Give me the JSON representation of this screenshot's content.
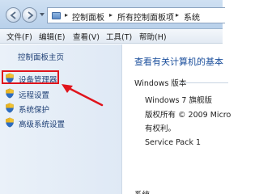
{
  "breadcrumb": {
    "items": [
      "控制面板",
      "所有控制面板项",
      "系统"
    ],
    "separator": "▸"
  },
  "menu": {
    "items": [
      "文件(F)",
      "编辑(E)",
      "查看(V)",
      "工具(T)",
      "帮助(H)"
    ]
  },
  "sidebar": {
    "home_label": "控制面板主页",
    "items": [
      {
        "label": "设备管理器",
        "icon": "shield-icon"
      },
      {
        "label": "远程设置",
        "icon": "shield-icon"
      },
      {
        "label": "系统保护",
        "icon": "shield-icon"
      },
      {
        "label": "高级系统设置",
        "icon": "shield-icon"
      }
    ],
    "highlighted_item": "设备管理器"
  },
  "main": {
    "title": "查看有关计算机的基本",
    "windows_edition_heading": "Windows 版本",
    "edition": "Windows 7 旗舰版",
    "copyright": "版权所有 © 2009 Micro",
    "rights": "有权利。",
    "service_pack": "Service Pack 1",
    "bottom_heading": "系统"
  },
  "colors": {
    "highlight": "#e0141c",
    "link": "#1e3f75",
    "title": "#1b4f9c"
  }
}
